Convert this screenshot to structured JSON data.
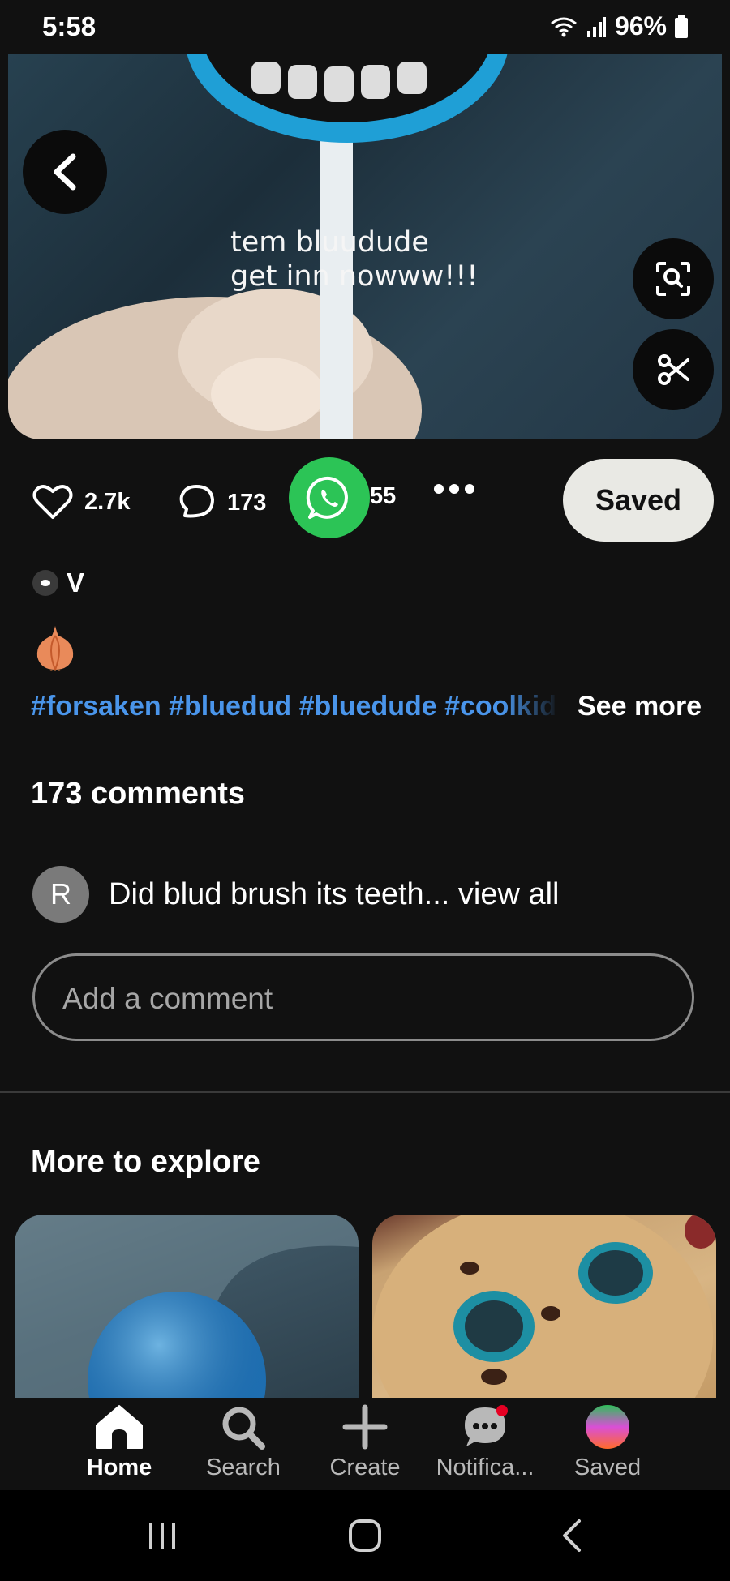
{
  "status_bar": {
    "time": "5:58",
    "battery": "96%"
  },
  "pin": {
    "caption": "tem bluudude\nget inn nowww!!!",
    "likes": "2.7k",
    "comments_count": "173",
    "shares": "55",
    "saved_label": "Saved",
    "author": "V",
    "hashtags": "#forsaken #bluedud #bluedude #coolkid",
    "see_more": "See more"
  },
  "comments": {
    "title": "173 comments",
    "preview": {
      "avatar_initial": "R",
      "text": "Did blud brush its teeth... view all"
    },
    "input_placeholder": "Add a comment"
  },
  "explore": {
    "title": "More to explore"
  },
  "bottom_nav": {
    "items": [
      {
        "label": "Home",
        "icon": "home-icon",
        "active": true
      },
      {
        "label": "Search",
        "icon": "search-icon",
        "active": false
      },
      {
        "label": "Create",
        "icon": "plus-icon",
        "active": false
      },
      {
        "label": "Notifica...",
        "icon": "chat-bubble-icon",
        "active": false
      },
      {
        "label": "Saved",
        "icon": "profile-avatar",
        "active": false
      }
    ]
  },
  "colors": {
    "accent_blue": "#4a95ea",
    "whatsapp_green": "#2cc456",
    "background": "#111111"
  }
}
